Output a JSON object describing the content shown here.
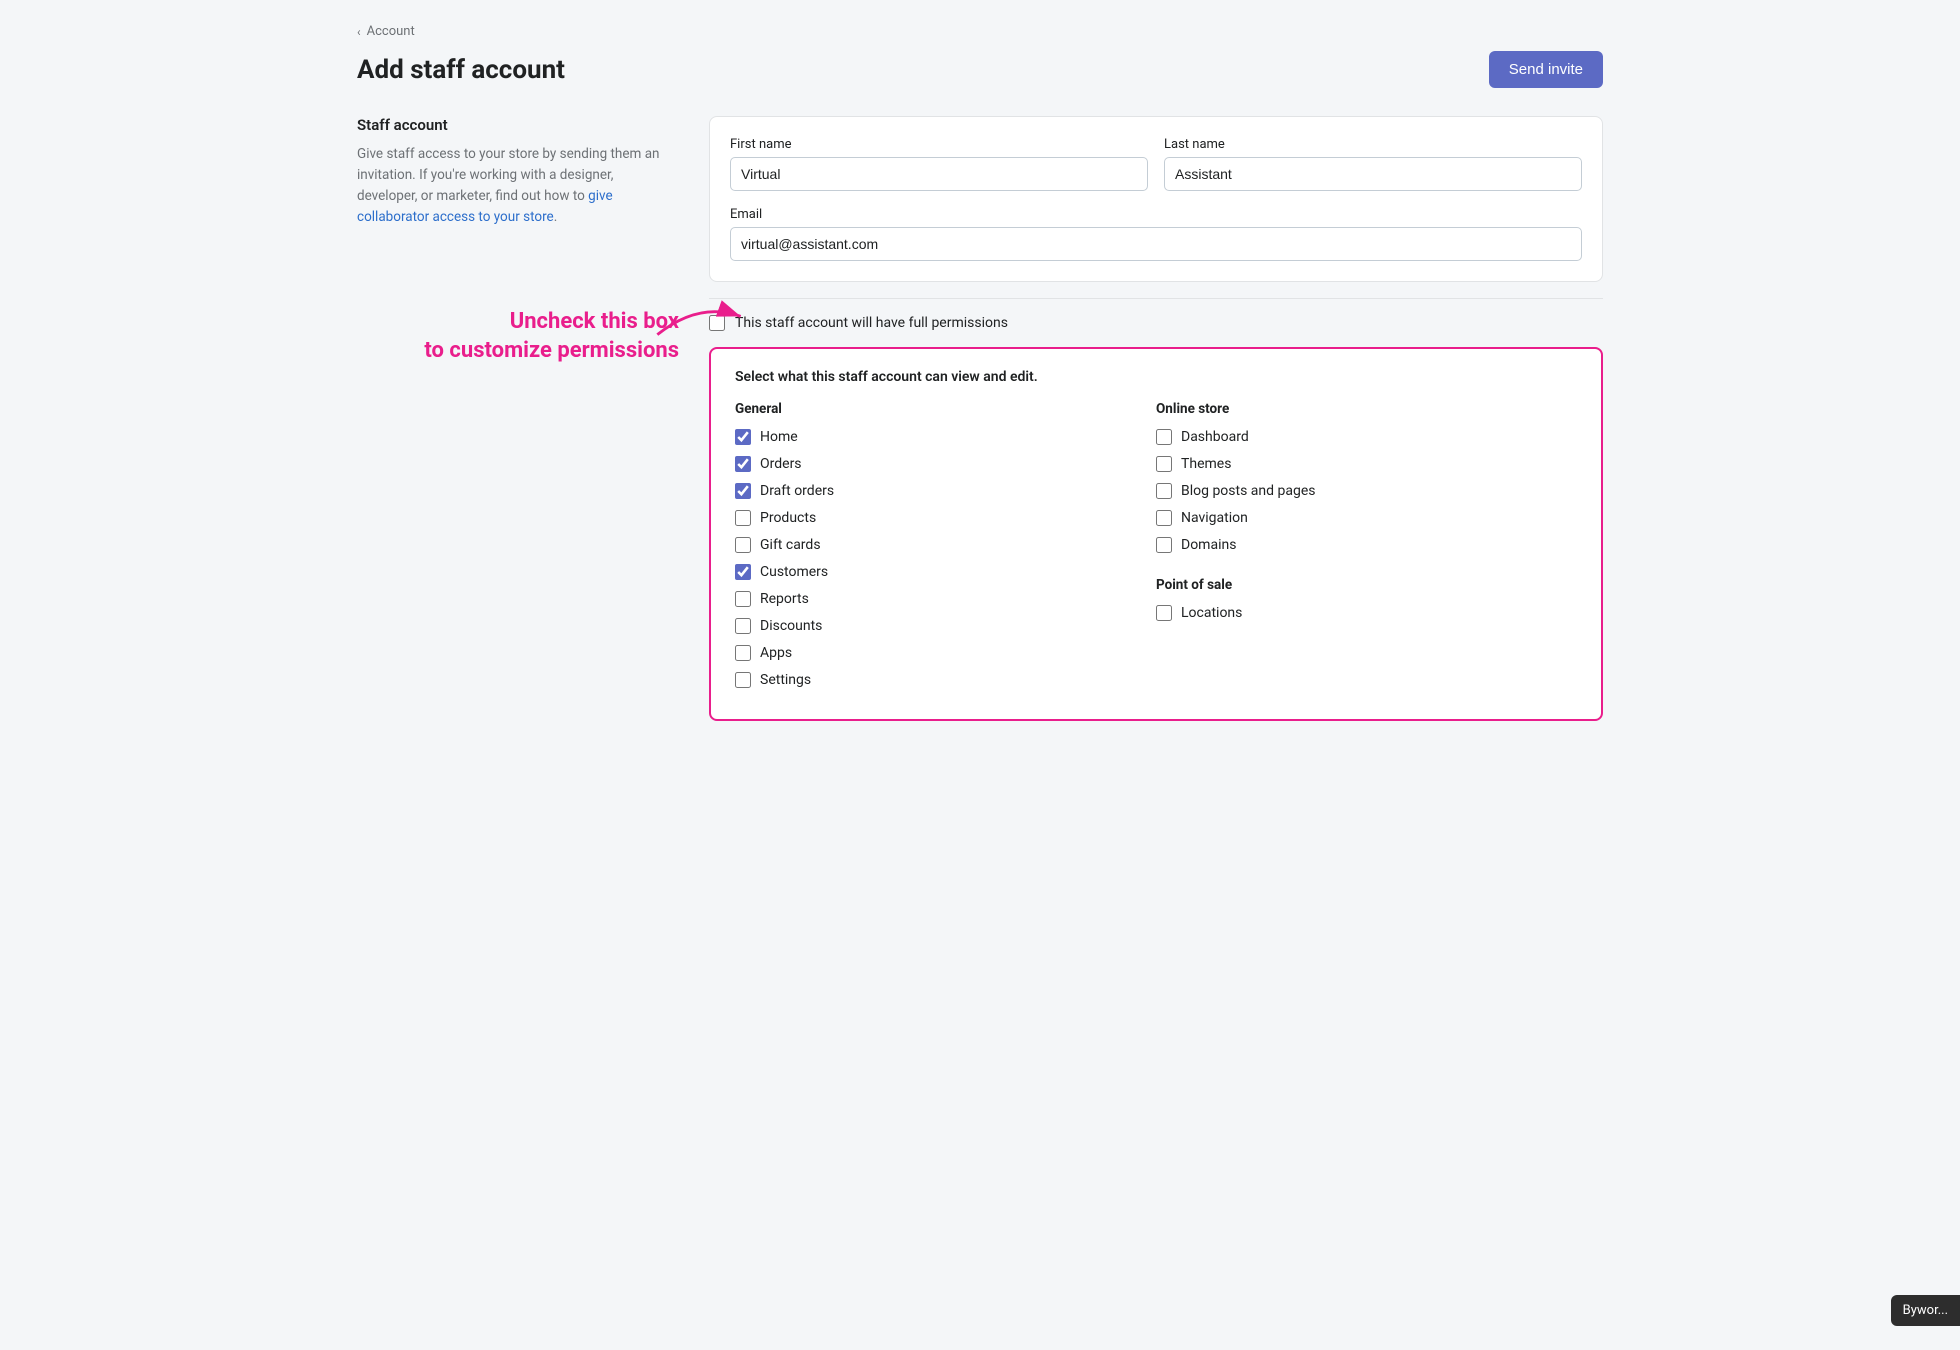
{
  "breadcrumb": {
    "label": "Account",
    "chevron": "‹"
  },
  "header": {
    "title": "Add staff account",
    "send_invite_label": "Send invite"
  },
  "sidebar": {
    "title": "Staff account",
    "description_plain": "Give staff access to your store by sending them an invitation. If you're working with a designer, developer, or marketer, find out how to ",
    "link_text": "give collaborator access to your store",
    "description_end": "."
  },
  "form": {
    "first_name_label": "First name",
    "first_name_value": "Virtual",
    "last_name_label": "Last name",
    "last_name_value": "Assistant",
    "email_label": "Email",
    "email_value": "virtual@assistant.com",
    "full_permissions_label": "This staff account will have full permissions"
  },
  "permissions": {
    "box_title": "Select what this staff account can view and edit.",
    "general_title": "General",
    "general_items": [
      {
        "label": "Home",
        "checked": true
      },
      {
        "label": "Orders",
        "checked": true
      },
      {
        "label": "Draft orders",
        "checked": true
      },
      {
        "label": "Products",
        "checked": false
      },
      {
        "label": "Gift cards",
        "checked": false
      },
      {
        "label": "Customers",
        "checked": true
      },
      {
        "label": "Reports",
        "checked": false
      },
      {
        "label": "Discounts",
        "checked": false
      },
      {
        "label": "Apps",
        "checked": false
      },
      {
        "label": "Settings",
        "checked": false
      }
    ],
    "online_store_title": "Online store",
    "online_store_items": [
      {
        "label": "Dashboard",
        "checked": false
      },
      {
        "label": "Themes",
        "checked": false
      },
      {
        "label": "Blog posts and pages",
        "checked": false
      },
      {
        "label": "Navigation",
        "checked": false
      },
      {
        "label": "Domains",
        "checked": false
      }
    ],
    "point_of_sale_title": "Point of sale",
    "point_of_sale_items": [
      {
        "label": "Locations",
        "checked": false
      }
    ]
  },
  "annotation": {
    "text": "Uncheck this box\nto customize permissions"
  },
  "byword_tooltip": "Bywor..."
}
